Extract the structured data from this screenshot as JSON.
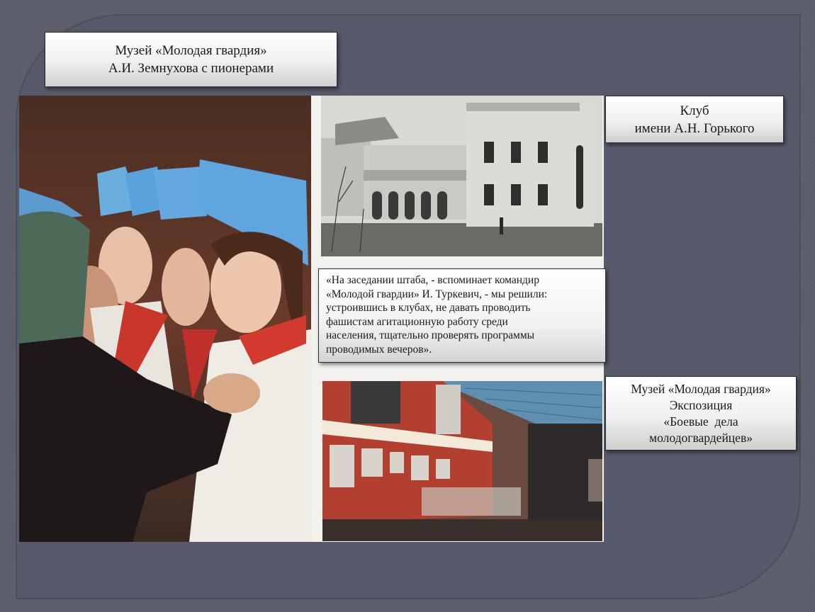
{
  "captions": {
    "museum_title": [
      "Музей «Молодая гвардия»",
      "А.И. Земнухова с пионерами"
    ],
    "club": [
      "Клуб",
      "имени А.Н. Горького"
    ],
    "exposition": [
      "Музей «Молодая гвардия»",
      "Экспозиция",
      "«Боевые  дела",
      "молодогвардейцев»"
    ]
  },
  "quote": {
    "lines": [
      "«На заседании штаба, - вспоминает командир",
      "«Молодой гвардии» И. Туркевич, - мы решили:",
      "устроившись в клубах, не давать проводить",
      "фашистам агитационную работу среди",
      "населения, тщательно проверять программы",
      "проводимых вечеров»."
    ]
  },
  "images": {
    "pioneers_photo": "pioneers-photo",
    "club_building_photo": "club-building-photo",
    "museum_exposition_photo": "museum-exposition-photo"
  }
}
